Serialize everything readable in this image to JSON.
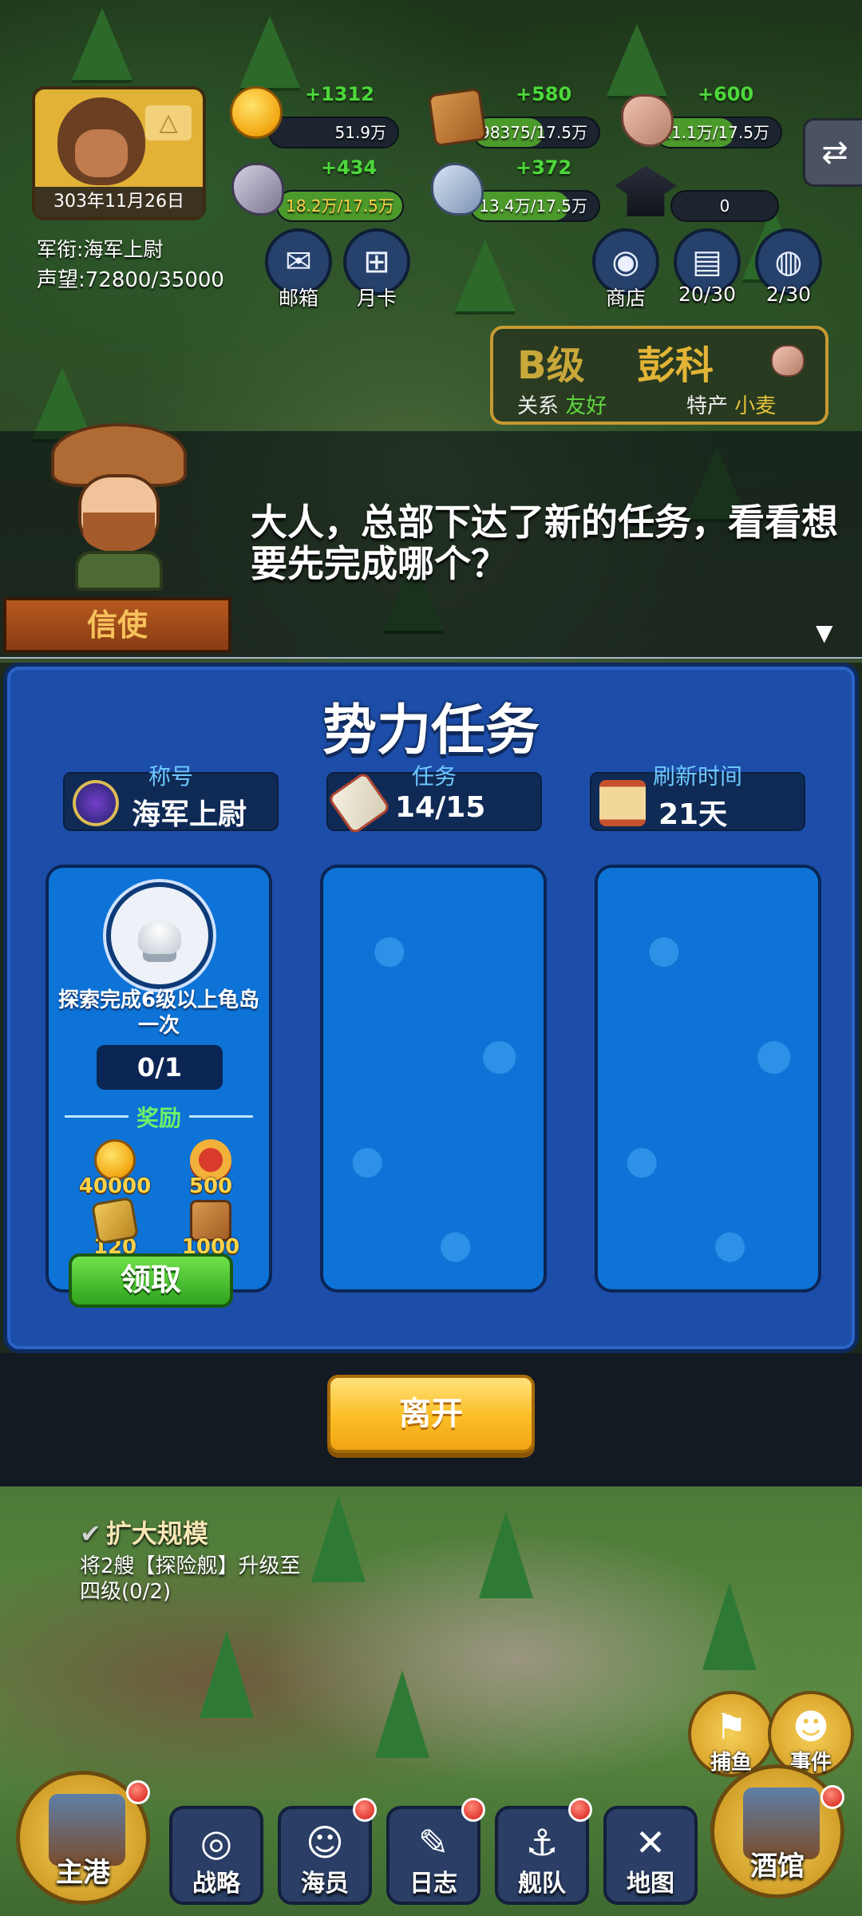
{
  "header": {
    "date": "303年11月26日",
    "rank_label": "军衔:",
    "rank_value": "海军上尉",
    "fame_label": "声望:",
    "fame_value": "72800/35000",
    "resources": [
      {
        "name": "gold",
        "gain": "+1312",
        "amount": "51.9万",
        "fill": 0
      },
      {
        "name": "wood",
        "gain": "+580",
        "amount": "98375/17.5万",
        "fill": 0.56
      },
      {
        "name": "stone",
        "gain": "+600",
        "amount": "11.1万/17.5万",
        "fill": 0.63
      },
      {
        "name": "ore",
        "gain": "+434",
        "amount": "18.2万/17.5万",
        "fill": 1.0
      },
      {
        "name": "crystal",
        "gain": "+372",
        "amount": "13.4万/17.5万",
        "fill": 0.77
      },
      {
        "name": "scholar",
        "gain": "",
        "amount": "0",
        "fill": 0
      }
    ],
    "buttons": {
      "mail": "邮箱",
      "monthly_card": "月卡",
      "shop": "商店",
      "books": "20/30",
      "backpack": "2/30"
    }
  },
  "faction": {
    "grade": "B级",
    "name": "彭科",
    "relation_label": "关系",
    "relation_value": "友好",
    "specialty_label": "特产",
    "specialty_value": "小麦"
  },
  "dialogue": {
    "speaker": "信使",
    "text": "大人，总部下达了新的任务，看看想要先完成哪个？"
  },
  "panel": {
    "title": "势力任务",
    "info": {
      "title_label": "称号",
      "title_value": "海军上尉",
      "task_label": "任务",
      "task_value": "14/15",
      "refresh_label": "刷新时间",
      "refresh_value": "21天"
    },
    "task": {
      "description": "探索完成6级以上龟岛一次",
      "progress": "0/1",
      "reward_label": "奖励",
      "rewards": [
        {
          "icon": "coin-icon",
          "value": "40000"
        },
        {
          "icon": "medal-icon",
          "value": "500"
        },
        {
          "icon": "bag-icon",
          "value": "120"
        },
        {
          "icon": "wood-icon",
          "value": "1000"
        }
      ],
      "claim": "领取"
    },
    "leave": "离开"
  },
  "quest_tip": {
    "title": "扩大规模",
    "detail": "将2艘【探险舰】升级至四级(0/2)"
  },
  "side_buttons": {
    "fishing": "捕鱼",
    "events": "事件"
  },
  "bottom_nav": {
    "home_port": "主港",
    "strategy": "战略",
    "crew": "海员",
    "log": "日志",
    "fleet": "舰队",
    "map": "地图",
    "tavern": "酒馆"
  }
}
